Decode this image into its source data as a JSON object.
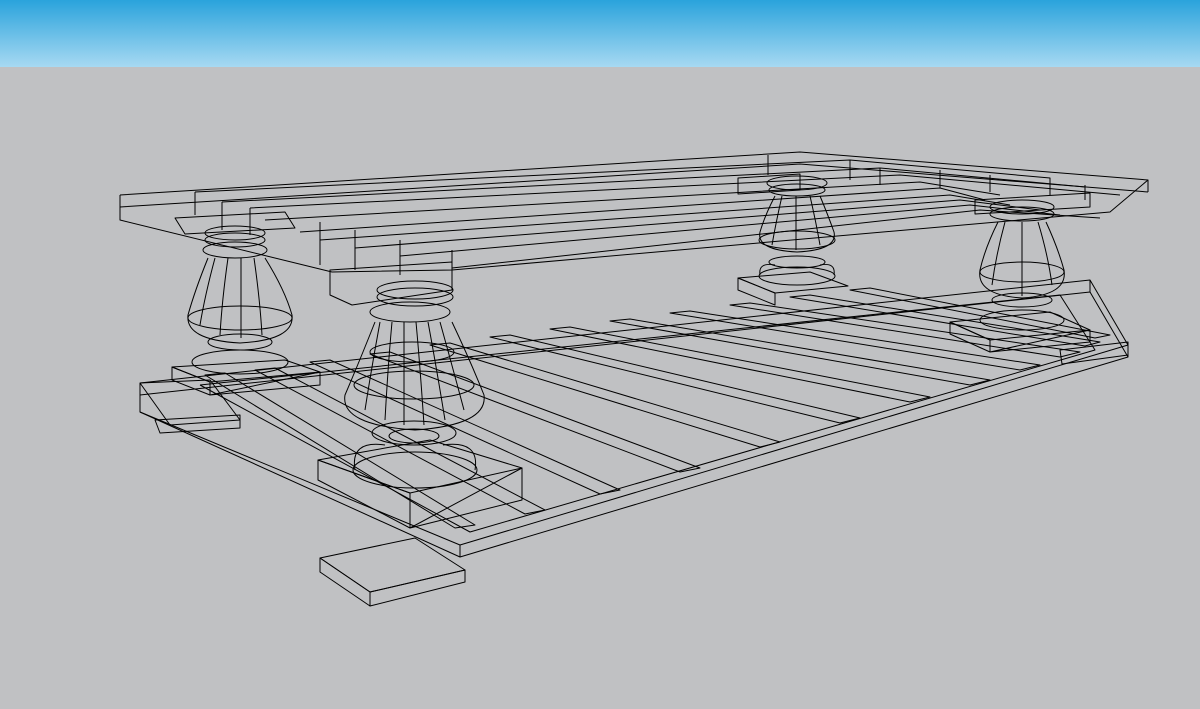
{
  "scene": {
    "sky_top_color": "#2aa3dc",
    "sky_bottom_color": "#a7d9f2",
    "ground_color": "#c0c1c3",
    "wire_color": "#000000",
    "object": "wireframe-coffee-table"
  }
}
